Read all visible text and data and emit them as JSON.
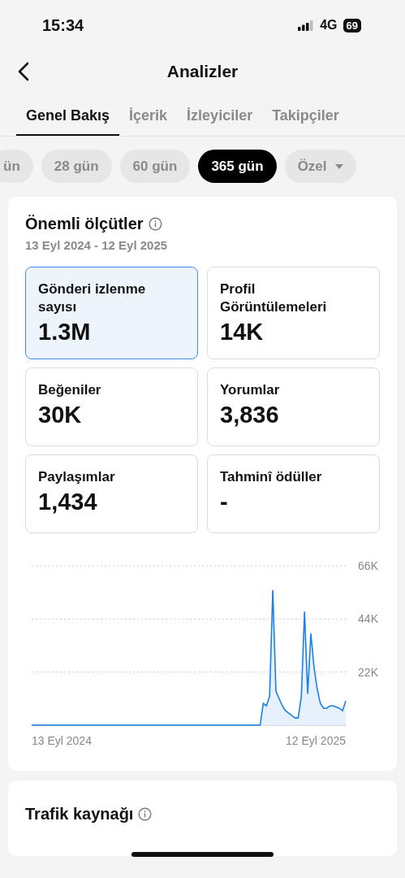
{
  "status_bar": {
    "time": "15:34",
    "network": "4G",
    "battery": "69"
  },
  "header": {
    "title": "Analizler"
  },
  "tabs": [
    {
      "label": "Genel Bakış",
      "selected": true
    },
    {
      "label": "İçerik",
      "selected": false
    },
    {
      "label": "İzleyiciler",
      "selected": false
    },
    {
      "label": "Takipçiler",
      "selected": false
    }
  ],
  "periods": [
    {
      "label": "ün",
      "selected": false,
      "kind": "chip"
    },
    {
      "label": "28 gün",
      "selected": false,
      "kind": "chip"
    },
    {
      "label": "60 gün",
      "selected": false,
      "kind": "chip"
    },
    {
      "label": "365 gün",
      "selected": true,
      "kind": "chip"
    },
    {
      "label": "Özel",
      "selected": false,
      "kind": "dropdown"
    }
  ],
  "key_metrics": {
    "title": "Önemli ölçütler",
    "date_range": "13 Eyl 2024 - 12 Eyl 2025",
    "metrics": [
      {
        "label": "Gönderi izlenme sayısı",
        "value": "1.3M",
        "selected": true
      },
      {
        "label": "Profil Görüntülemeleri",
        "value": "14K",
        "selected": false
      },
      {
        "label": "Beğeniler",
        "value": "30K",
        "selected": false
      },
      {
        "label": "Yorumlar",
        "value": "3,836",
        "selected": false
      },
      {
        "label": "Paylaşımlar",
        "value": "1,434",
        "selected": false
      },
      {
        "label": "Tahminî ödüller",
        "value": "-",
        "selected": false
      }
    ],
    "chart_start_label": "13 Eyl 2024",
    "chart_end_label": "12 Eyl 2025",
    "chart_data": {
      "type": "area",
      "series": [
        {
          "color": "#1a7fe8",
          "values": [
            0,
            0,
            0,
            0,
            0,
            0,
            0,
            0,
            0,
            0,
            0,
            0,
            0,
            0,
            0,
            0,
            0,
            0,
            0,
            0,
            0,
            0,
            0,
            0,
            0,
            0,
            0,
            0,
            0,
            0,
            0,
            0,
            0,
            0,
            0,
            0,
            0,
            0,
            0,
            0,
            0,
            0,
            0,
            0,
            0,
            0,
            0,
            0,
            0,
            0,
            0,
            0,
            0,
            0,
            0,
            0,
            0,
            0,
            0,
            0,
            0,
            0,
            0,
            0,
            0,
            0,
            0,
            0,
            0,
            0,
            0,
            0,
            0,
            9000,
            8000,
            12000,
            56000,
            14000,
            11000,
            8000,
            6000,
            5000,
            4000,
            3000,
            3000,
            12000,
            47000,
            13000,
            38000,
            24000,
            15000,
            9000,
            7000,
            7000,
            8000,
            8000,
            7500,
            7000,
            6000,
            10000
          ]
        }
      ],
      "ylim": [
        0,
        66000
      ],
      "yticks": [
        {
          "value": 22000,
          "label": "22K"
        },
        {
          "value": 44000,
          "label": "44K"
        },
        {
          "value": 66000,
          "label": "66K"
        }
      ]
    }
  },
  "traffic": {
    "title": "Trafik kaynağı"
  }
}
